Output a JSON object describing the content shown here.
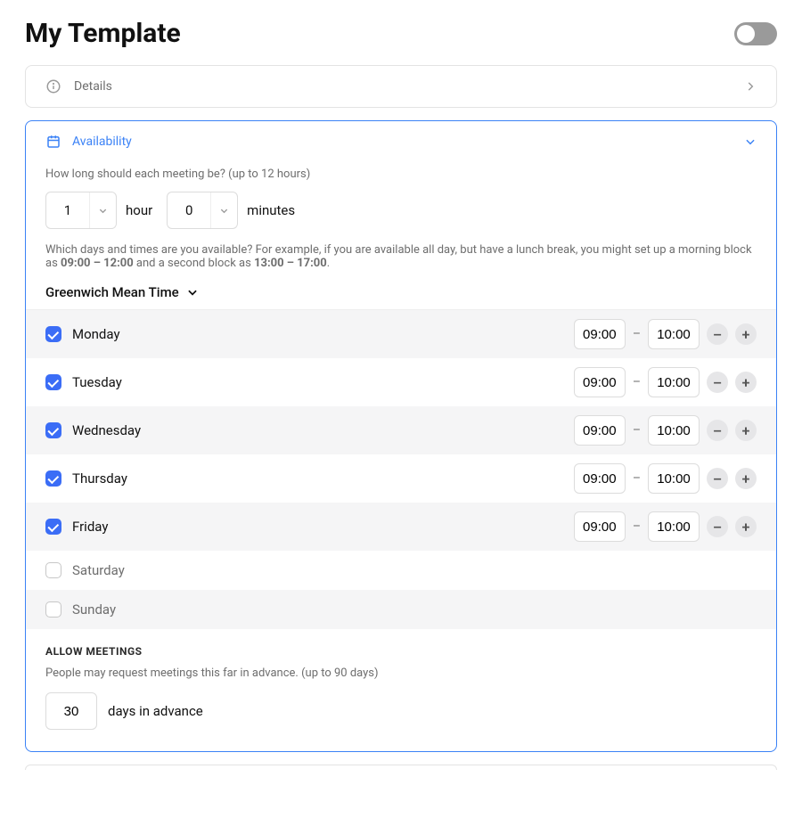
{
  "header": {
    "title": "My Template",
    "enabled": false
  },
  "details": {
    "label": "Details"
  },
  "availability": {
    "label": "Availability",
    "duration_help": "How long should each meeting be? (up to 12 hours)",
    "hours_value": "1",
    "hours_label": "hour",
    "minutes_value": "0",
    "minutes_label": "minutes",
    "days_help_prefix": "Which days and times are you available? For example, if you are available all day, but have a lunch break, you might set up a morning block as ",
    "days_help_bold1": "09:00 – 12:00",
    "days_help_mid": " and a second block as ",
    "days_help_bold2": "13:00 – 17:00",
    "days_help_suffix": ".",
    "timezone": "Greenwich Mean Time",
    "days": [
      {
        "name": "Monday",
        "enabled": true,
        "start": "09:00",
        "end": "10:00"
      },
      {
        "name": "Tuesday",
        "enabled": true,
        "start": "09:00",
        "end": "10:00"
      },
      {
        "name": "Wednesday",
        "enabled": true,
        "start": "09:00",
        "end": "10:00"
      },
      {
        "name": "Thursday",
        "enabled": true,
        "start": "09:00",
        "end": "10:00"
      },
      {
        "name": "Friday",
        "enabled": true,
        "start": "09:00",
        "end": "10:00"
      },
      {
        "name": "Saturday",
        "enabled": false
      },
      {
        "name": "Sunday",
        "enabled": false
      }
    ],
    "allow": {
      "heading": "ALLOW MEETINGS",
      "help": "People may request meetings this far in advance. (up to 90 days)",
      "days_value": "30",
      "days_label": "days in advance"
    }
  },
  "colors": {
    "accent": "#3b82f6",
    "checkbox": "#3b6df6"
  }
}
